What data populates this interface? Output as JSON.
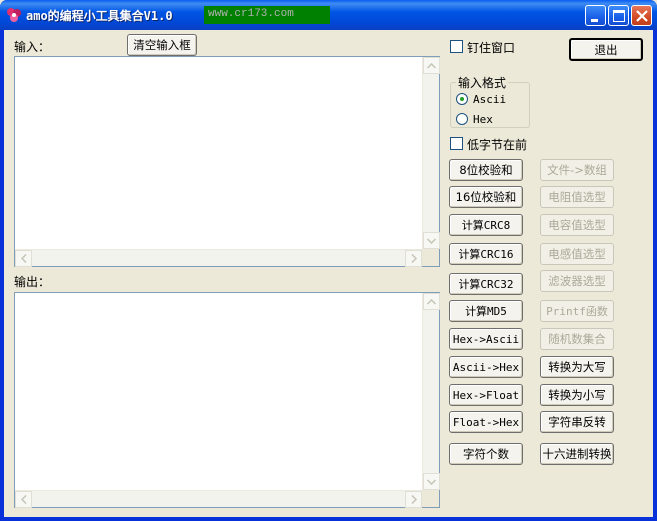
{
  "window": {
    "title": "amo的编程小工具集合V1.0",
    "url_badge": "www.cr173.com"
  },
  "colors": {
    "titlebar": "#0055e5",
    "client_bg": "#ece9d8",
    "url_badge_bg": "#008000",
    "disabled_text": "#aca899"
  },
  "icons": [
    "app-icon",
    "minimize-icon",
    "maximize-icon",
    "close-icon",
    "arrow-up-icon",
    "arrow-down-icon",
    "arrow-left-icon",
    "arrow-right-icon"
  ],
  "input": {
    "label": "输入：",
    "clear_button": "清空输入框",
    "value": ""
  },
  "output": {
    "label": "输出：",
    "value": ""
  },
  "options": {
    "pin_window": "钉住窗口",
    "pin_window_checked": false,
    "exit_button": "退出",
    "format_group": "输入格式",
    "format_ascii": "Ascii",
    "format_hex": "Hex",
    "format_selected": "Ascii",
    "low_byte_first": "低字节在前",
    "low_byte_first_checked": false
  },
  "left_buttons": [
    "8位校验和",
    "16位校验和",
    "计算CRC8",
    "计算CRC16",
    "计算CRC32",
    "计算MD5",
    "Hex->Ascii",
    "Ascii->Hex",
    "Hex->Float",
    "Float->Hex",
    "字符个数"
  ],
  "right_buttons": [
    {
      "label": "文件->数组",
      "enabled": false
    },
    {
      "label": "电阻值选型",
      "enabled": false
    },
    {
      "label": "电容值选型",
      "enabled": false
    },
    {
      "label": "电感值选型",
      "enabled": false
    },
    {
      "label": "滤波器选型",
      "enabled": false
    },
    {
      "label": "Printf函数",
      "enabled": false
    },
    {
      "label": "随机数集合",
      "enabled": false
    },
    {
      "label": "转换为大写",
      "enabled": true
    },
    {
      "label": "转换为小写",
      "enabled": true
    },
    {
      "label": "字符串反转",
      "enabled": true
    },
    {
      "label": "十六进制转换",
      "enabled": true
    }
  ]
}
